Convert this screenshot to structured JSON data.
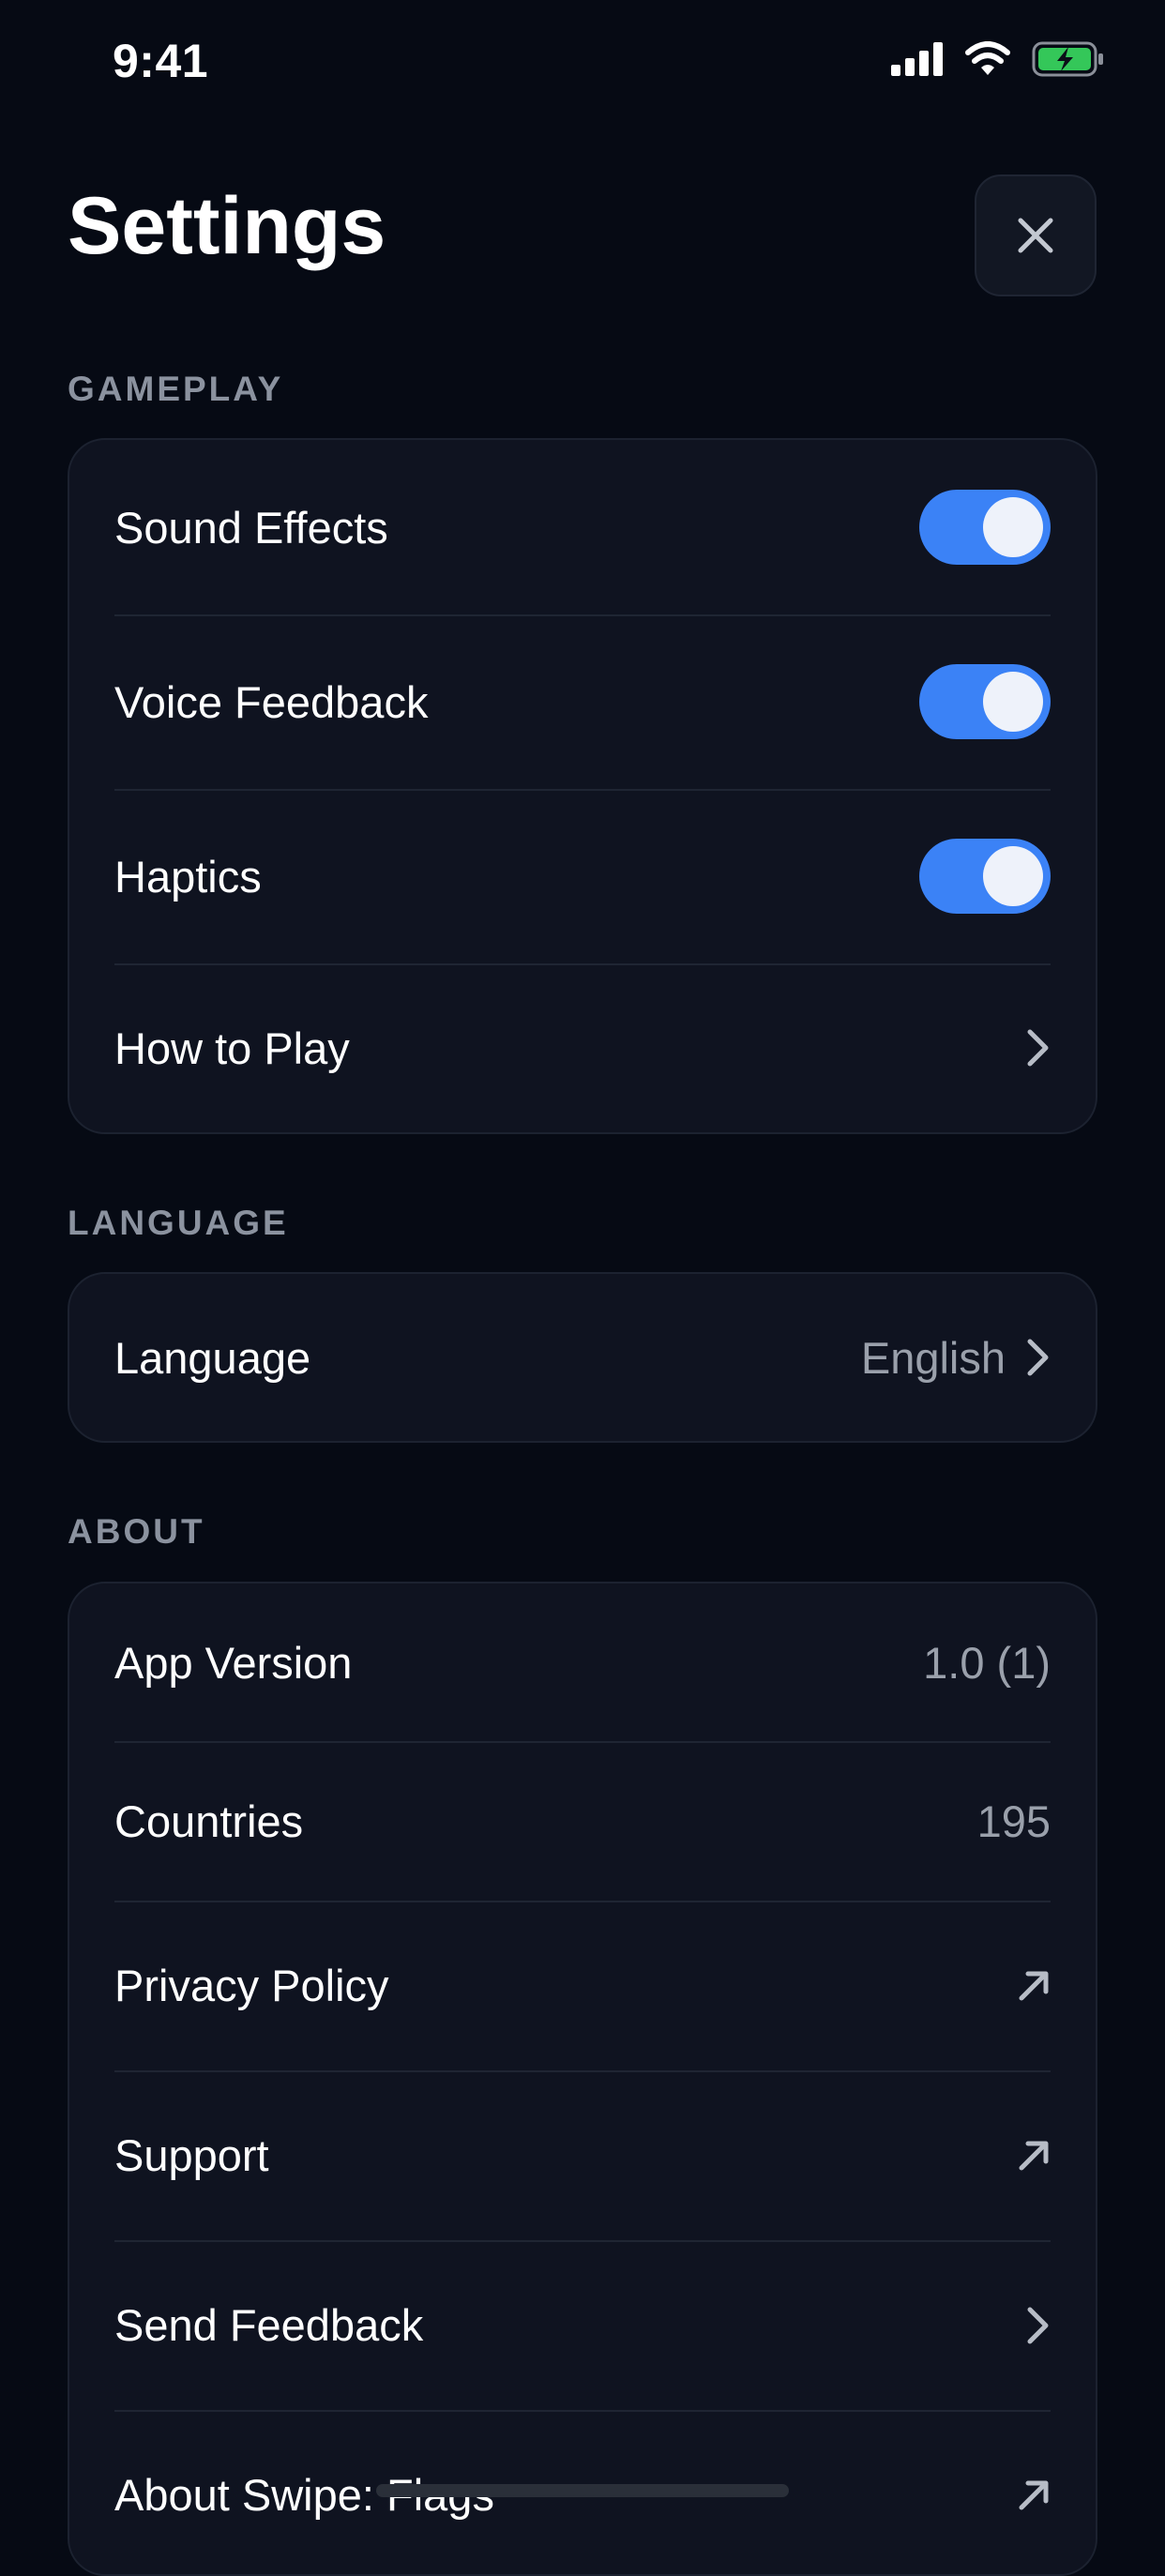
{
  "status": {
    "time": "9:41"
  },
  "header": {
    "title": "Settings"
  },
  "sections": {
    "gameplay": {
      "header": "GAMEPLAY",
      "sound_effects": {
        "label": "Sound Effects",
        "on": true
      },
      "voice_feedback": {
        "label": "Voice Feedback",
        "on": true
      },
      "haptics": {
        "label": "Haptics",
        "on": true
      },
      "how_to_play": {
        "label": "How to Play"
      }
    },
    "language": {
      "header": "LANGUAGE",
      "language": {
        "label": "Language",
        "value": "English"
      }
    },
    "about": {
      "header": "ABOUT",
      "app_version": {
        "label": "App Version",
        "value": "1.0 (1)"
      },
      "countries": {
        "label": "Countries",
        "value": "195"
      },
      "privacy_policy": {
        "label": "Privacy Policy"
      },
      "support": {
        "label": "Support"
      },
      "send_feedback": {
        "label": "Send Feedback"
      },
      "about_app": {
        "label": "About Swipe: Flags"
      }
    }
  },
  "colors": {
    "accent": "#3b82f6",
    "background": "#060a14",
    "card": "#0f1320",
    "battery": "#34c759"
  },
  "icons": [
    "signal-icon",
    "wifi-icon",
    "battery-charging-icon",
    "close-icon",
    "chevron-right-icon",
    "external-link-icon"
  ]
}
